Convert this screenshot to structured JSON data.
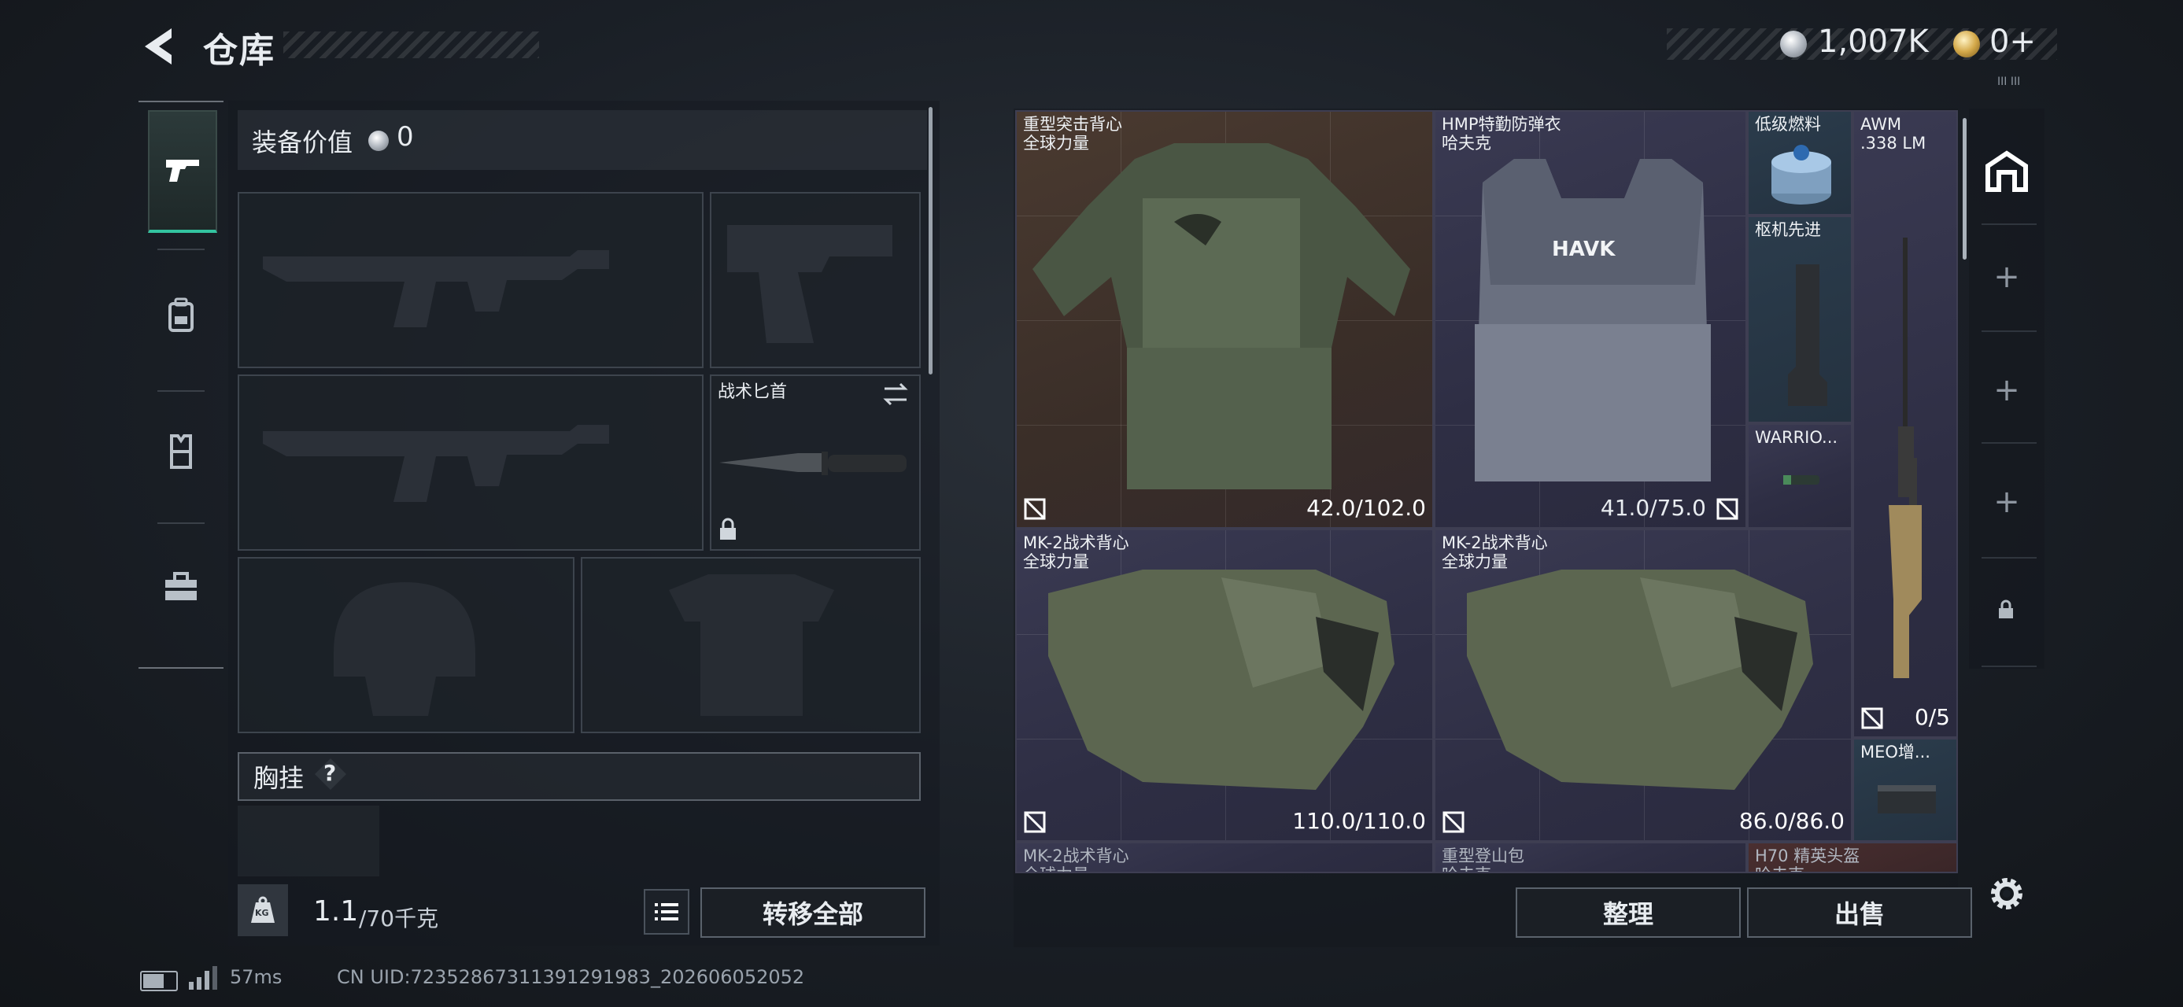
{
  "header": {
    "title": "仓库",
    "money": "1,007K",
    "gold": "0+",
    "version": "III III"
  },
  "left_nav": {
    "tabs": [
      {
        "name": "weapons",
        "icon": "pistol-icon"
      },
      {
        "name": "backpack",
        "icon": "backpack-icon"
      },
      {
        "name": "vest",
        "icon": "vest-icon"
      },
      {
        "name": "toolbox",
        "icon": "toolbox-icon"
      }
    ]
  },
  "equipment": {
    "value_label": "装备价值",
    "value": "0",
    "knife_label": "战术匕首",
    "chest_label": "胸挂",
    "chest_help": "?",
    "weight_value": "1.1",
    "weight_cap": "/70千克",
    "kg_badge": "KG",
    "transfer_label": "转移全部"
  },
  "storage": {
    "items": [
      {
        "name": "重型突击背心",
        "brand": "全球力量",
        "durability": "42.0/102.0"
      },
      {
        "name": "HMP特勤防弹衣",
        "brand": "哈夫克",
        "durability": "41.0/75.0",
        "logo": "HAVK"
      },
      {
        "name": "低级燃料"
      },
      {
        "name": "AWM",
        "brand": ".338 LM",
        "durability": "0/5"
      },
      {
        "name": "枢机先进"
      },
      {
        "name": "WARRIO..."
      },
      {
        "name": "MK-2战术背心",
        "brand": "全球力量",
        "durability": "110.0/110.0"
      },
      {
        "name": "MK-2战术背心",
        "brand": "全球力量",
        "durability": "86.0/86.0"
      },
      {
        "name": "MEO增..."
      },
      {
        "name": "MK-2战术背心",
        "brand": "全球力量"
      },
      {
        "name": "重型登山包",
        "brand": "哈夫克"
      },
      {
        "name": "H70 精英头盔",
        "brand": "哈夫克"
      }
    ],
    "sort_label": "整理",
    "sell_label": "出售"
  },
  "status": {
    "ping": "57ms",
    "uid": "CN UID:72352867311391291983_202606052052"
  },
  "colors": {
    "accent": "#33c4a0",
    "cell_brown": "#3a2e28",
    "cell_purple": "#2e2e44",
    "cell_blue": "#243240",
    "cell_red": "#3a2628"
  }
}
